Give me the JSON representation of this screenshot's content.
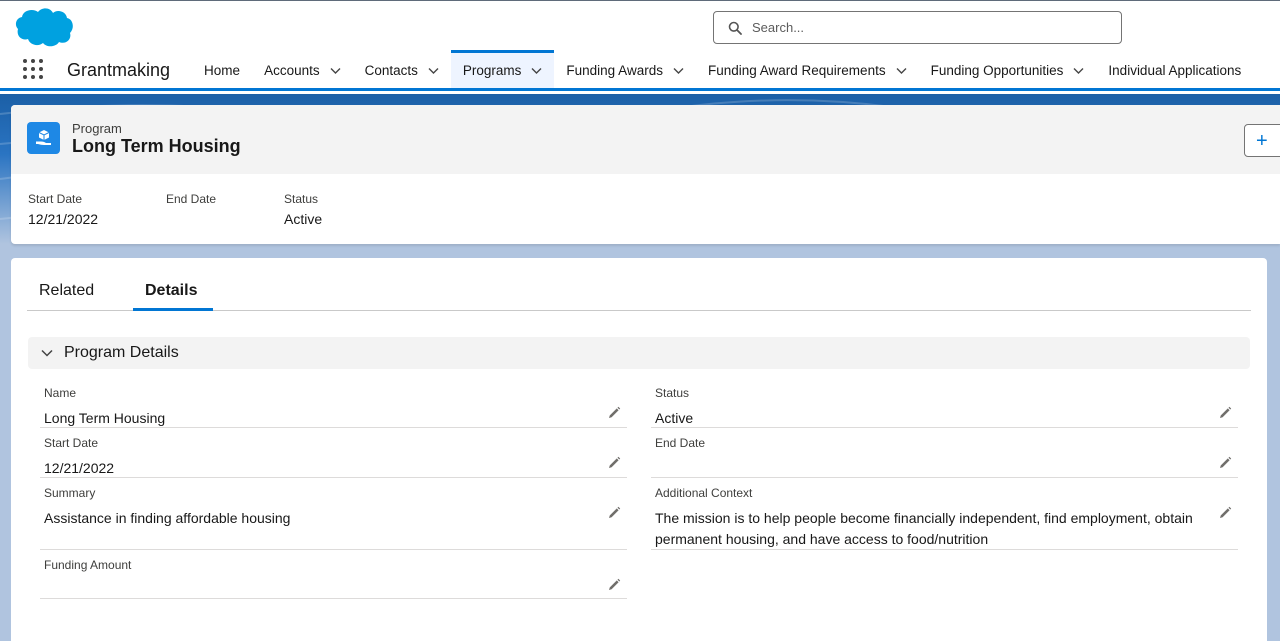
{
  "search": {
    "placeholder": "Search..."
  },
  "app": {
    "name": "Grantmaking"
  },
  "nav": {
    "items": [
      {
        "label": "Home",
        "has_menu": false
      },
      {
        "label": "Accounts",
        "has_menu": true
      },
      {
        "label": "Contacts",
        "has_menu": true
      },
      {
        "label": "Programs",
        "has_menu": true,
        "active": true
      },
      {
        "label": "Funding Awards",
        "has_menu": true
      },
      {
        "label": "Funding Award Requirements",
        "has_menu": true
      },
      {
        "label": "Funding Opportunities",
        "has_menu": true
      },
      {
        "label": "Individual Applications",
        "has_menu": false
      }
    ]
  },
  "record": {
    "type": "Program",
    "title": "Long Term Housing",
    "follow_label": "+",
    "highlights": [
      {
        "label": "Start Date",
        "value": "12/21/2022"
      },
      {
        "label": "End Date",
        "value": ""
      },
      {
        "label": "Status",
        "value": "Active"
      }
    ]
  },
  "tabs": {
    "related": "Related",
    "details": "Details"
  },
  "section": {
    "title": "Program Details"
  },
  "fields": {
    "name": {
      "label": "Name",
      "value": "Long Term Housing"
    },
    "status": {
      "label": "Status",
      "value": "Active"
    },
    "start_date": {
      "label": "Start Date",
      "value": "12/21/2022"
    },
    "end_date": {
      "label": "End Date",
      "value": ""
    },
    "summary": {
      "label": "Summary",
      "value": "Assistance in finding affordable housing"
    },
    "additional_context": {
      "label": "Additional Context",
      "value": "The mission is to help people become financially independent, find employment, obtain permanent housing, and have access to food/nutrition"
    },
    "funding_amount": {
      "label": "Funding Amount",
      "value": ""
    }
  },
  "colors": {
    "brand": "#0176d3",
    "salesforce_cloud": "#00a1e0",
    "record_icon": "#1e88e5",
    "band_top": "#1b5fa6"
  },
  "icons": {
    "logo": "salesforce-cloud-logo",
    "app_launcher": "waffle-icon",
    "search": "search-icon",
    "nav_menu": "chevron-down-icon",
    "record": "program-icon",
    "edit": "pencil-icon"
  }
}
